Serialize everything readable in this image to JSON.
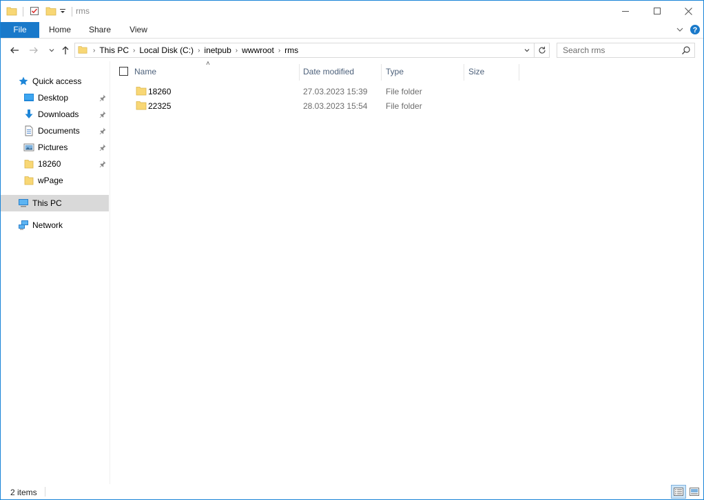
{
  "window": {
    "title": "rms"
  },
  "ribbon": {
    "tabs": [
      {
        "label": "File"
      },
      {
        "label": "Home"
      },
      {
        "label": "Share"
      },
      {
        "label": "View"
      }
    ]
  },
  "address": {
    "crumbs": [
      "This PC",
      "Local Disk (C:)",
      "inetpub",
      "wwwroot",
      "rms"
    ]
  },
  "search": {
    "placeholder": "Search rms"
  },
  "nav": {
    "quick_access": "Quick access",
    "items": [
      {
        "label": "Desktop",
        "icon": "desktop-icon",
        "pinned": true
      },
      {
        "label": "Downloads",
        "icon": "downloads-icon",
        "pinned": true
      },
      {
        "label": "Documents",
        "icon": "documents-icon",
        "pinned": true
      },
      {
        "label": "Pictures",
        "icon": "pictures-icon",
        "pinned": true
      },
      {
        "label": "18260",
        "icon": "folder-icon",
        "pinned": true
      },
      {
        "label": "wPage",
        "icon": "folder-icon",
        "pinned": false
      }
    ],
    "this_pc": "This PC",
    "network": "Network"
  },
  "columns": {
    "name": "Name",
    "date_modified": "Date modified",
    "type": "Type",
    "size": "Size"
  },
  "files": [
    {
      "name": "18260",
      "date_modified": "27.03.2023 15:39",
      "type": "File folder",
      "size": ""
    },
    {
      "name": "22325",
      "date_modified": "28.03.2023 15:54",
      "type": "File folder",
      "size": ""
    }
  ],
  "status": {
    "item_count": "2 items"
  },
  "colors": {
    "accent": "#1979ca",
    "folder": "#f8d775",
    "selection": "#d9d9d9",
    "column_header": "#4c607a"
  }
}
